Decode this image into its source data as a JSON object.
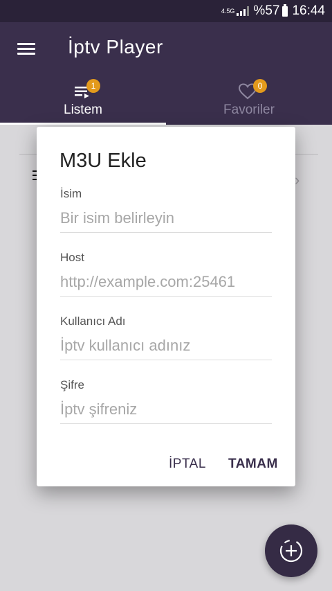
{
  "status_bar": {
    "network": "4.5G",
    "battery": "%57",
    "time": "16:44"
  },
  "app_bar": {
    "title": "İptv Player",
    "tabs": [
      {
        "label": "Listem",
        "badge": "1",
        "icon": "playlist-icon",
        "active": true
      },
      {
        "label": "Favoriler",
        "badge": "0",
        "icon": "heart-icon",
        "active": false
      }
    ]
  },
  "dialog": {
    "title": "M3U Ekle",
    "fields": [
      {
        "label": "İsim",
        "placeholder": "Bir isim belirleyin",
        "value": ""
      },
      {
        "label": "Host",
        "placeholder": "http://example.com:25461",
        "value": ""
      },
      {
        "label": "Kullanıcı Adı",
        "placeholder": "İptv kullanıcı adınız",
        "value": ""
      },
      {
        "label": "Şifre",
        "placeholder": "İptv şifreniz",
        "value": ""
      }
    ],
    "cancel_label": "İPTAL",
    "ok_label": "TAMAM"
  },
  "fab": {
    "icon": "add-circle-icon"
  },
  "colors": {
    "primary": "#3a2f4c",
    "status_bar": "#2a2238",
    "badge": "#e39a1c",
    "fab": "#352b45"
  }
}
